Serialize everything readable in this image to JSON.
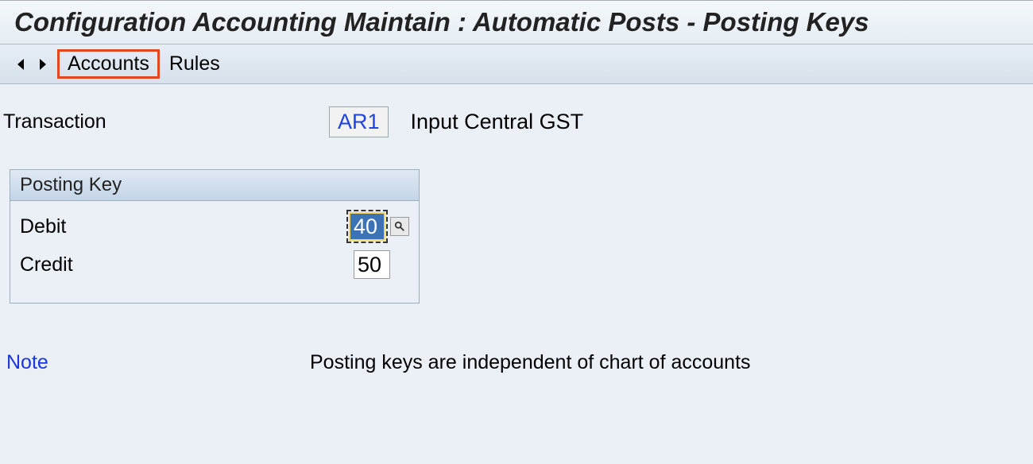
{
  "header": {
    "title": "Configuration Accounting Maintain : Automatic Posts - Posting Keys"
  },
  "toolbar": {
    "accounts_label": "Accounts",
    "rules_label": "Rules"
  },
  "transaction": {
    "label": "Transaction",
    "code": "AR1",
    "description": "Input Central GST"
  },
  "posting_key": {
    "panel_title": "Posting Key",
    "debit_label": "Debit",
    "debit_value": "40",
    "credit_label": "Credit",
    "credit_value": "50"
  },
  "note": {
    "label": "Note",
    "text": "Posting keys are independent of chart of accounts"
  }
}
